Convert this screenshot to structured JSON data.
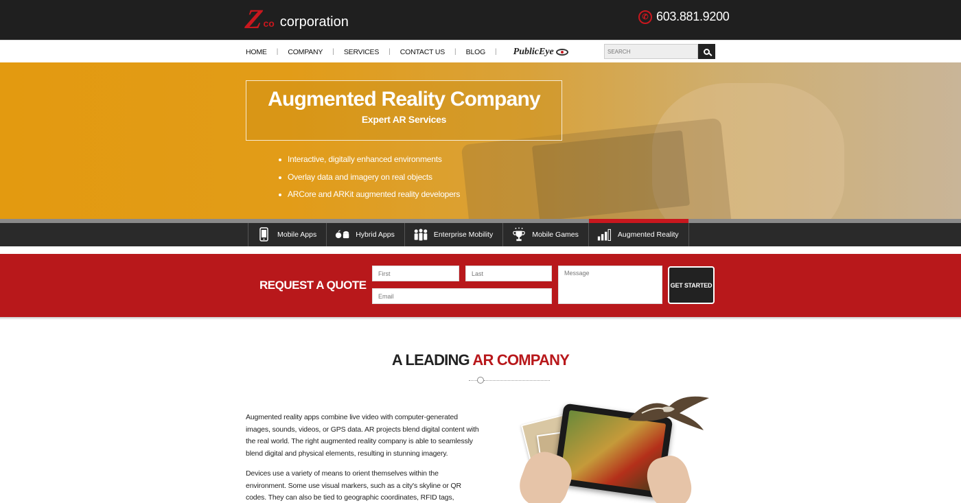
{
  "header": {
    "logo_z": "Z",
    "logo_co": "co",
    "logo_text": "corporation",
    "phone": "603.881.9200",
    "phone_icon": "phone-icon"
  },
  "nav": {
    "items": [
      "HOME",
      "COMPANY",
      "SERVICES",
      "CONTACT US",
      "BLOG"
    ],
    "partner_logo": "PublicEye",
    "search_placeholder": "SEARCH"
  },
  "hero": {
    "title": "Augmented Reality Company",
    "subtitle": "Expert AR Services",
    "bullets": [
      "Interactive, digitally enhanced environments",
      "Overlay data and imagery on real objects",
      "ARCore and ARKit augmented reality developers"
    ],
    "accent_color": "#e39a10"
  },
  "services_tabs": [
    {
      "label": "Mobile Apps",
      "icon": "mobile-phone-icon",
      "active": false
    },
    {
      "label": "Hybrid Apps",
      "icon": "apple-android-icon",
      "active": false
    },
    {
      "label": "Enterprise Mobility",
      "icon": "people-group-icon",
      "active": false
    },
    {
      "label": "Mobile Games",
      "icon": "trophy-icon",
      "active": false
    },
    {
      "label": "Augmented Reality",
      "icon": "bar-chart-icon",
      "active": true
    }
  ],
  "quote": {
    "title": "REQUEST A QUOTE",
    "first_placeholder": "First",
    "last_placeholder": "Last",
    "email_placeholder": "Email",
    "message_placeholder": "Message",
    "button_label": "GET STARTED",
    "band_color": "#b8181b"
  },
  "content": {
    "heading_black": "A LEADING ",
    "heading_red": "AR COMPANY",
    "paragraph1": "Augmented reality apps combine live video with computer-generated images, sounds, videos, or GPS data. AR projects blend digital content with the real world. The right augmented reality company is able to seamlessly blend digital and physical elements, resulting in stunning imagery.",
    "paragraph2": "Devices use a variety of means to orient themselves within the environment. Some use visual markers, such as a city's skyline or QR codes. They can also be tied to geographic coordinates, RFID tags, proximity to other devices, and many"
  }
}
